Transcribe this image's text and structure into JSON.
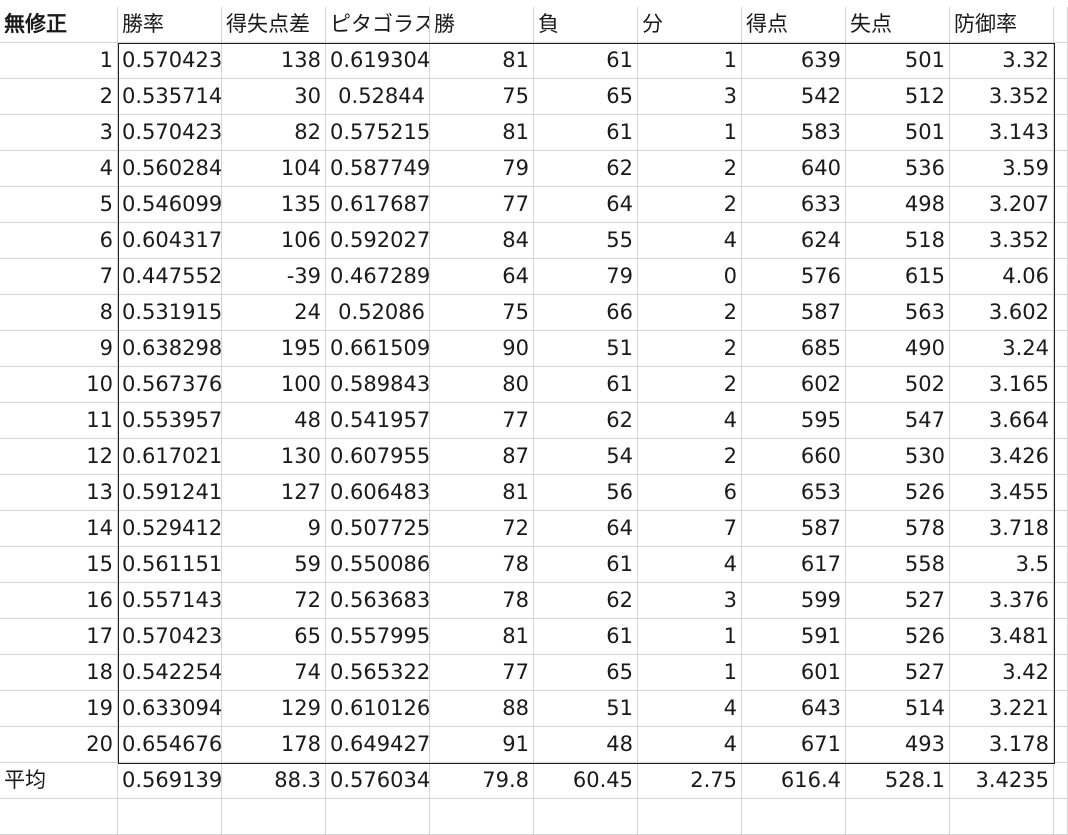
{
  "header": {
    "corner": "無修正",
    "columns": [
      "勝率",
      "得失点差",
      "ピタゴラス",
      "勝",
      "負",
      "分",
      "得点",
      "失点",
      "防御率"
    ]
  },
  "rows": [
    [
      "1",
      "0.570423",
      "138",
      "0.619304",
      "81",
      "61",
      "1",
      "639",
      "501",
      "3.32"
    ],
    [
      "2",
      "0.535714",
      "30",
      "0.52844",
      "75",
      "65",
      "3",
      "542",
      "512",
      "3.352"
    ],
    [
      "3",
      "0.570423",
      "82",
      "0.575215",
      "81",
      "61",
      "1",
      "583",
      "501",
      "3.143"
    ],
    [
      "4",
      "0.560284",
      "104",
      "0.587749",
      "79",
      "62",
      "2",
      "640",
      "536",
      "3.59"
    ],
    [
      "5",
      "0.546099",
      "135",
      "0.617687",
      "77",
      "64",
      "2",
      "633",
      "498",
      "3.207"
    ],
    [
      "6",
      "0.604317",
      "106",
      "0.592027",
      "84",
      "55",
      "4",
      "624",
      "518",
      "3.352"
    ],
    [
      "7",
      "0.447552",
      "-39",
      "0.467289",
      "64",
      "79",
      "0",
      "576",
      "615",
      "4.06"
    ],
    [
      "8",
      "0.531915",
      "24",
      "0.52086",
      "75",
      "66",
      "2",
      "587",
      "563",
      "3.602"
    ],
    [
      "9",
      "0.638298",
      "195",
      "0.661509",
      "90",
      "51",
      "2",
      "685",
      "490",
      "3.24"
    ],
    [
      "10",
      "0.567376",
      "100",
      "0.589843",
      "80",
      "61",
      "2",
      "602",
      "502",
      "3.165"
    ],
    [
      "11",
      "0.553957",
      "48",
      "0.541957",
      "77",
      "62",
      "4",
      "595",
      "547",
      "3.664"
    ],
    [
      "12",
      "0.617021",
      "130",
      "0.607955",
      "87",
      "54",
      "2",
      "660",
      "530",
      "3.426"
    ],
    [
      "13",
      "0.591241",
      "127",
      "0.606483",
      "81",
      "56",
      "6",
      "653",
      "526",
      "3.455"
    ],
    [
      "14",
      "0.529412",
      "9",
      "0.507725",
      "72",
      "64",
      "7",
      "587",
      "578",
      "3.718"
    ],
    [
      "15",
      "0.561151",
      "59",
      "0.550086",
      "78",
      "61",
      "4",
      "617",
      "558",
      "3.5"
    ],
    [
      "16",
      "0.557143",
      "72",
      "0.563683",
      "78",
      "62",
      "3",
      "599",
      "527",
      "3.376"
    ],
    [
      "17",
      "0.570423",
      "65",
      "0.557995",
      "81",
      "61",
      "1",
      "591",
      "526",
      "3.481"
    ],
    [
      "18",
      "0.542254",
      "74",
      "0.565322",
      "77",
      "65",
      "1",
      "601",
      "527",
      "3.42"
    ],
    [
      "19",
      "0.633094",
      "129",
      "0.610126",
      "88",
      "51",
      "4",
      "643",
      "514",
      "3.221"
    ],
    [
      "20",
      "0.654676",
      "178",
      "0.649427",
      "91",
      "48",
      "4",
      "671",
      "493",
      "3.178"
    ]
  ],
  "average": {
    "label": "平均",
    "values": [
      "0.569139",
      "88.3",
      "0.576034",
      "79.8",
      "60.45",
      "2.75",
      "616.4",
      "528.1",
      "3.4235"
    ]
  }
}
